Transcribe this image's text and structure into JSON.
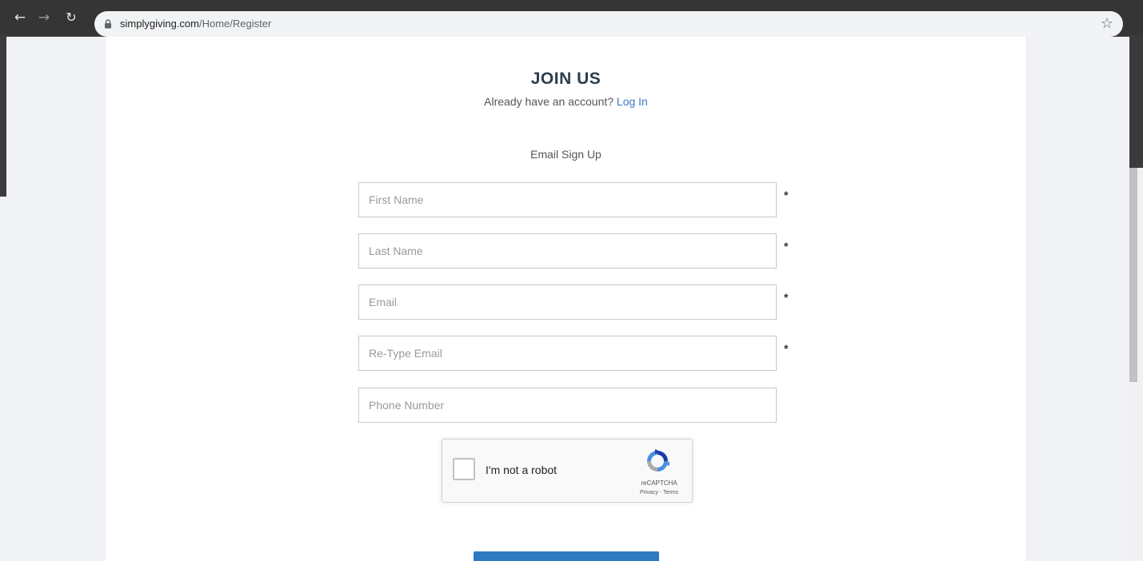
{
  "browser": {
    "url_host": "simplygiving.com",
    "url_path": "/Home/Register"
  },
  "page": {
    "title": "JOIN US",
    "subtitle_prefix": "Already have an account? ",
    "login_link": "Log In",
    "section_label": "Email Sign Up"
  },
  "form": {
    "first_name": {
      "placeholder": "First Name",
      "value": "",
      "required_mark": "*"
    },
    "last_name": {
      "placeholder": "Last Name",
      "value": "",
      "required_mark": "*"
    },
    "email": {
      "placeholder": "Email",
      "value": "",
      "required_mark": "*"
    },
    "retype_email": {
      "placeholder": "Re-Type Email",
      "value": "",
      "required_mark": "*"
    },
    "phone": {
      "placeholder": "Phone Number",
      "value": ""
    }
  },
  "recaptcha": {
    "label": "I'm not a robot",
    "brand": "reCAPTCHA",
    "links": "Privacy - Terms",
    "checked": false
  },
  "icons": {
    "back": "arrow-left-icon",
    "forward": "arrow-right-icon",
    "reload": "reload-icon",
    "lock": "lock-icon",
    "bookmark": "star-icon",
    "recaptcha_logo": "recaptcha-logo-icon"
  },
  "colors": {
    "title": "#2c3e50",
    "link": "#3a7bbf",
    "button": "#2e7bc0"
  }
}
